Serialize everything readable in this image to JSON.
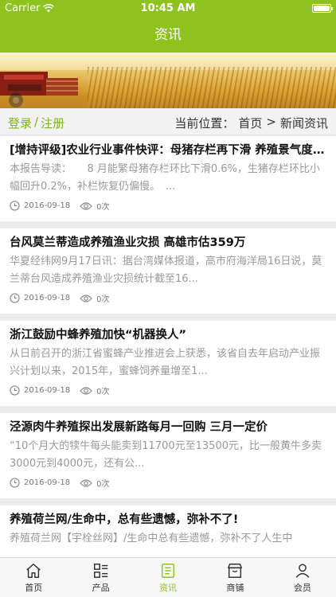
{
  "status_bar": {
    "carrier": "Carrier",
    "time": "10:45 AM"
  },
  "nav": {
    "title": "资讯"
  },
  "breadcrumb": {
    "login": "登录",
    "separator": "/",
    "register": "注册",
    "current_label": "当前位置：",
    "home": "首页",
    "arrow": ">",
    "current": "新闻资讯"
  },
  "articles": [
    {
      "title": "[增持评级]农业行业事件快评：母猪存栏再下滑 养殖景气度上行",
      "desc": "本报告导读：　　8 月能繁母猪存栏环比下滑0.6%，生猪存栏环比小幅回升0.2%，补栏恢复仍偏慢。　…",
      "date": "2016-09-18",
      "views": "0次"
    },
    {
      "title": "台风莫兰蒂造成养殖渔业灾损 高雄市估359万",
      "desc": "华夏经纬网9月17日讯：据台湾媒体报道，高市府海洋局16日说，莫兰蒂台风造成养殖渔业灾损统计截至16...",
      "date": "2016-09-18",
      "views": "0次"
    },
    {
      "title": "浙江鼓励中蜂养殖加快“机器换人”",
      "desc": "从日前召开的浙江省蜜蜂产业推进会上获悉，该省自去年启动产业振兴计划以来，2015年，蜜蜂饲养量增至1...",
      "date": "2016-09-18",
      "views": "0次"
    },
    {
      "title": "泾源肉牛养殖探出发展新路每月一回购 三月一定价",
      "desc": "“10个月大的犊牛每头能卖到11700元至13500元，比一般黄牛多卖3000元到4000元，还有公...",
      "date": "2016-09-18",
      "views": "0次"
    },
    {
      "title": "养殖荷兰网/生命中，总有些遗憾，弥补不了!",
      "desc": "养殖荷兰网【宇栓丝网】/生命中总有些遗憾，弥补不了人生中",
      "date": "",
      "views": ""
    }
  ],
  "tabs": [
    {
      "label": "首页",
      "icon": "home-icon"
    },
    {
      "label": "产品",
      "icon": "product-list-icon"
    },
    {
      "label": "资讯",
      "icon": "news-icon"
    },
    {
      "label": "商铺",
      "icon": "shop-icon"
    },
    {
      "label": "会员",
      "icon": "member-icon"
    }
  ],
  "colors": {
    "brand": "#8dc21f",
    "text_muted": "#999999"
  }
}
